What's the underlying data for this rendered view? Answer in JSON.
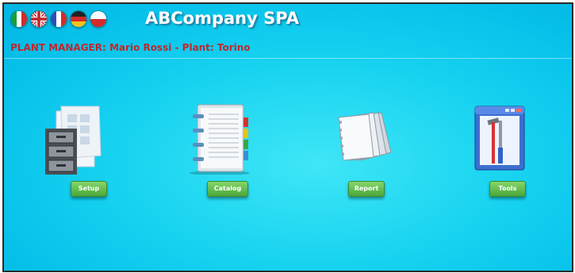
{
  "header": {
    "company_name": "ABCompany SPA",
    "manager_line": "PLANT MANAGER: Mario Rossi - Plant: Torino",
    "flags": [
      "italy-flag-icon",
      "uk-flag-icon",
      "france-flag-icon",
      "germany-flag-icon",
      "poland-flag-icon"
    ]
  },
  "menu": {
    "items": [
      {
        "label": "Setup",
        "icon": "setup-icon"
      },
      {
        "label": "Catalog",
        "icon": "catalog-icon"
      },
      {
        "label": "Report",
        "icon": "report-icon"
      },
      {
        "label": "Tools",
        "icon": "tools-icon"
      }
    ]
  },
  "colors": {
    "background": "#17d3f0",
    "manager_text": "#c0272d",
    "button": "#5cb848"
  }
}
